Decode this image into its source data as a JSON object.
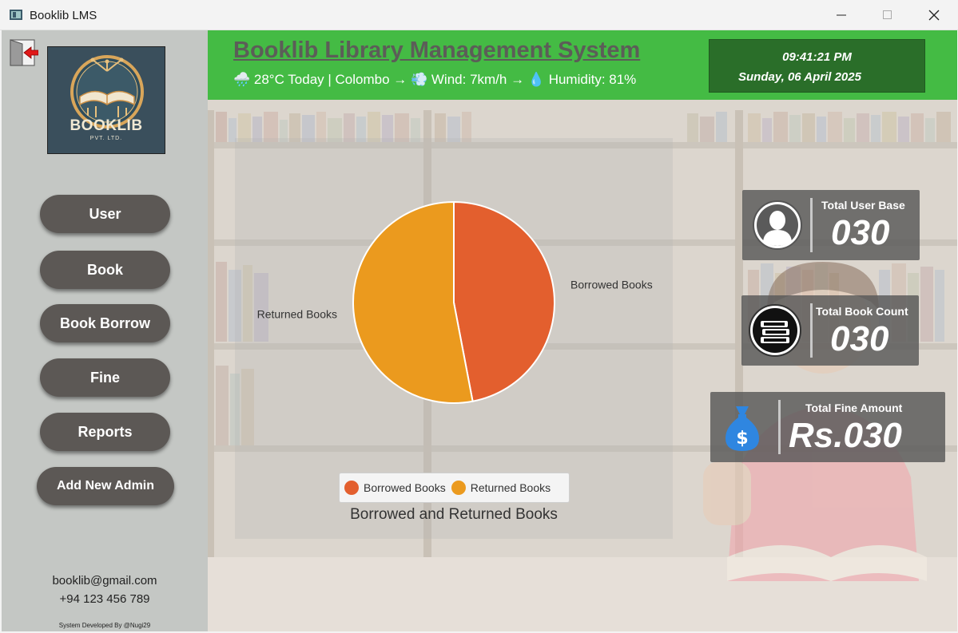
{
  "window": {
    "title": "Booklib LMS",
    "minimize_glyph": "—",
    "maximize_glyph": "☐",
    "close_glyph": "✕"
  },
  "sidebar": {
    "logo_text": "BOOKLIB",
    "logo_subtext": "PVT. LTD.",
    "buttons": [
      {
        "id": "user",
        "label": "User"
      },
      {
        "id": "book",
        "label": "Book"
      },
      {
        "id": "borrow",
        "label": "Book Borrow"
      },
      {
        "id": "fine",
        "label": "Fine"
      },
      {
        "id": "reports",
        "label": "Reports"
      },
      {
        "id": "admin",
        "label": "Add New Admin"
      }
    ],
    "contact_email": "booklib@gmail.com",
    "contact_phone": "+94 123 456 789",
    "developer": "System Developed By @Nugi29"
  },
  "header": {
    "title": "Booklib Library Management System",
    "weather": "🌧️ 28°C Today | Colombo → 💨 Wind: 7km/h → 💧 Humidity: 81%",
    "time": "09:41:21 PM",
    "date": "Sunday, 06 April 2025",
    "accent_color": "#44bb44"
  },
  "chart_data": {
    "type": "pie",
    "title": "Borrowed and Returned Books",
    "slices": [
      {
        "label": "Borrowed Books",
        "value": 47,
        "color": "#e35f2e"
      },
      {
        "label": "Returned Books",
        "value": 53,
        "color": "#eb9a1e"
      }
    ],
    "legend": [
      "Borrowed Books",
      "Returned Books"
    ],
    "legend_position": "bottom"
  },
  "stats": {
    "users": {
      "label": "Total User Base",
      "value": "030"
    },
    "books": {
      "label": "Total Book Count",
      "value": "030"
    },
    "fines": {
      "label": "Total Fine Amount",
      "value": "Rs.030"
    }
  }
}
